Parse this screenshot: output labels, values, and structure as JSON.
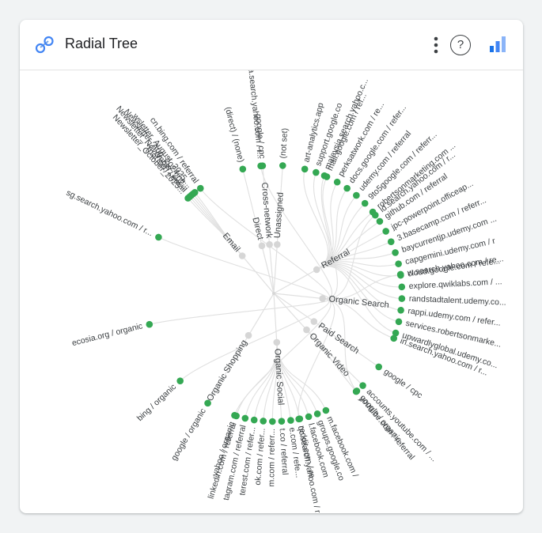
{
  "header": {
    "title": "Radial Tree",
    "help_label": "?",
    "logo_icon": "radial-tree-logo-icon",
    "more_icon": "more-vert-icon",
    "chart_icon": "bar-chart-icon"
  },
  "colors": {
    "leaf": "#34a853",
    "internal": "#d6d6d6",
    "link": "#e0e0e0",
    "label": "#3c4043",
    "accent_blue": "#4285f4"
  },
  "chart_data": {
    "type": "radial-tree",
    "root": "",
    "groups": [
      {
        "name": "Organic Search",
        "leaves": [
          "sg.search.yahoo.com / r...",
          "cn.bing.com / referral",
          "ca.search.yahoo.com / r...",
          "malaysia.search.yahoo.c...",
          "id.search.yahoo.com / r...",
          "w.search.yahoo.com / re...",
          "in.search.yahoo.com / r...",
          "google / organic",
          "qc.search.yahoo.com / r...",
          "yahoo / organic",
          "bing / organic",
          "ecosia.org / organic"
        ]
      },
      {
        "name": "Email",
        "leaves": [
          "Newsletter_October_2025...",
          "(not set) / email",
          "Newsletter_November_202...",
          "Newsletter_Aug_2024 / e...",
          "wsletter_August_2025 ..."
        ]
      },
      {
        "name": "Direct",
        "leaves": [
          "(direct) / (none)"
        ]
      },
      {
        "name": "Cross-network",
        "leaves": [
          "google / cpc"
        ]
      },
      {
        "name": "Unassigned",
        "leaves": [
          "(not set)"
        ]
      },
      {
        "name": "Referral",
        "leaves": [
          "art-analytics.app",
          "support.google.co",
          "mail.google.com / ref...",
          "perksatwork.com / re...",
          "docs.google.com / refer...",
          "udemy.com / referral",
          "9to5google.com / referr...",
          "robertsonmarketing.com ...",
          "github.com / referral",
          "jpc-powerpoint.officeap...",
          "3.basecamp.com / referr...",
          "baycurrentjp.udemy.com ...",
          "capgemini.udemy.com / r",
          "cloud.google.com / refe...",
          "explore.qwiklabs.com / ...",
          "randstadtalent.udemy.co...",
          "rappi.udemy.com / refer...",
          "services.robertsonmarke...",
          "upwardlyglobal.udemy.co..."
        ]
      },
      {
        "name": "Paid Search",
        "leaves": [
          "google / cpc"
        ]
      },
      {
        "name": "Organic Video",
        "leaves": [
          "accounts.youtube.com / ...",
          "youtube.com / referral"
        ]
      },
      {
        "name": "Organic Social",
        "leaves": [
          "m.facebook.com /",
          "groups.google.co",
          "l.facebook.com",
          "reddit.com / re",
          "e.com / refe...",
          "t.co / referral",
          "m.com / referr...",
          "ok.com / refer...",
          "terest.com / refer...",
          "tagram.com / referral",
          "linkedin.com / referral"
        ]
      },
      {
        "name": "Organic Shopping",
        "leaves": [
          "google / organic"
        ]
      }
    ]
  }
}
